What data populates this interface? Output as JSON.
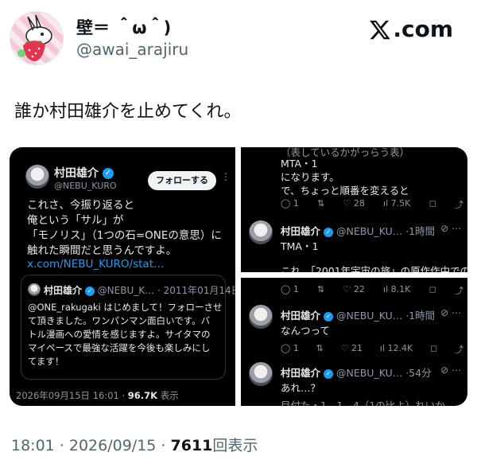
{
  "author": {
    "display_name": "壁＝ ＾ω＾)",
    "handle": "@awai_arajiru"
  },
  "brand": {
    "text": ".com"
  },
  "tweet": {
    "text": "誰か村田雄介を止めてくれ。"
  },
  "left_pane": {
    "name": "村田雄介",
    "handle": "@NEBU_KURO",
    "follow_label": "フォローする",
    "body": "これさ、今振り返ると\n俺という「サル」が\n「モノリス」（1つの石=ONEの意思）に\n触れた瞬間だと思うんですよ。",
    "link": "x.com/NEBU_KURO/stat…",
    "quote": {
      "name": "村田雄介",
      "handle": "@NEBU_K…",
      "date": "· 2011年01月14日",
      "body": "@ONE_rakugaki はじめまして！フォローさせ\nて頂きました。ワンパンマン面白いです。バ\nトル漫画への愛情を感じますよ。サイタマの\nマイペースで最強な活躍を今後も楽しみにし\nてます！"
    },
    "footer_date": "2026年09月15日 16:01 · ",
    "footer_views": "96.7K",
    "footer_suffix": " 表示"
  },
  "top_right": {
    "line0": "（表しているかがっらう表）",
    "line1": "MTA・1",
    "line2": "になります。",
    "line3": "で、ちょっと順番を変えると",
    "actions": {
      "reply": "1",
      "repost": "",
      "like": "28",
      "views": "7.5K"
    },
    "reply": {
      "name": "村田雄介",
      "handle": "@NEBU_KU… ·",
      "time": "1時間",
      "text1": "TMA・1",
      "text2": "これ、「2001年宇宙の旅」の原作作中での"
    }
  },
  "bottom_right": {
    "actions1": {
      "reply": "1",
      "repost": "",
      "like": "22",
      "views": "8.1K"
    },
    "reply1": {
      "name": "村田雄介",
      "handle": "@NEBU_KU… ·",
      "time": "1時間",
      "text": "なんつって"
    },
    "actions2": {
      "reply": "1",
      "repost": "",
      "like": "21",
      "views": "12.4K"
    },
    "reply2": {
      "name": "村田雄介",
      "handle": "@NEBU_KU… ·",
      "time": "54分",
      "text": "あれ…？",
      "cut": "目付た・1　1．4（1の比よ）れいか"
    }
  },
  "footer": {
    "time_date": "18:01 · 2026/09/15 · ",
    "views": "7611",
    "views_label": "回表示"
  }
}
